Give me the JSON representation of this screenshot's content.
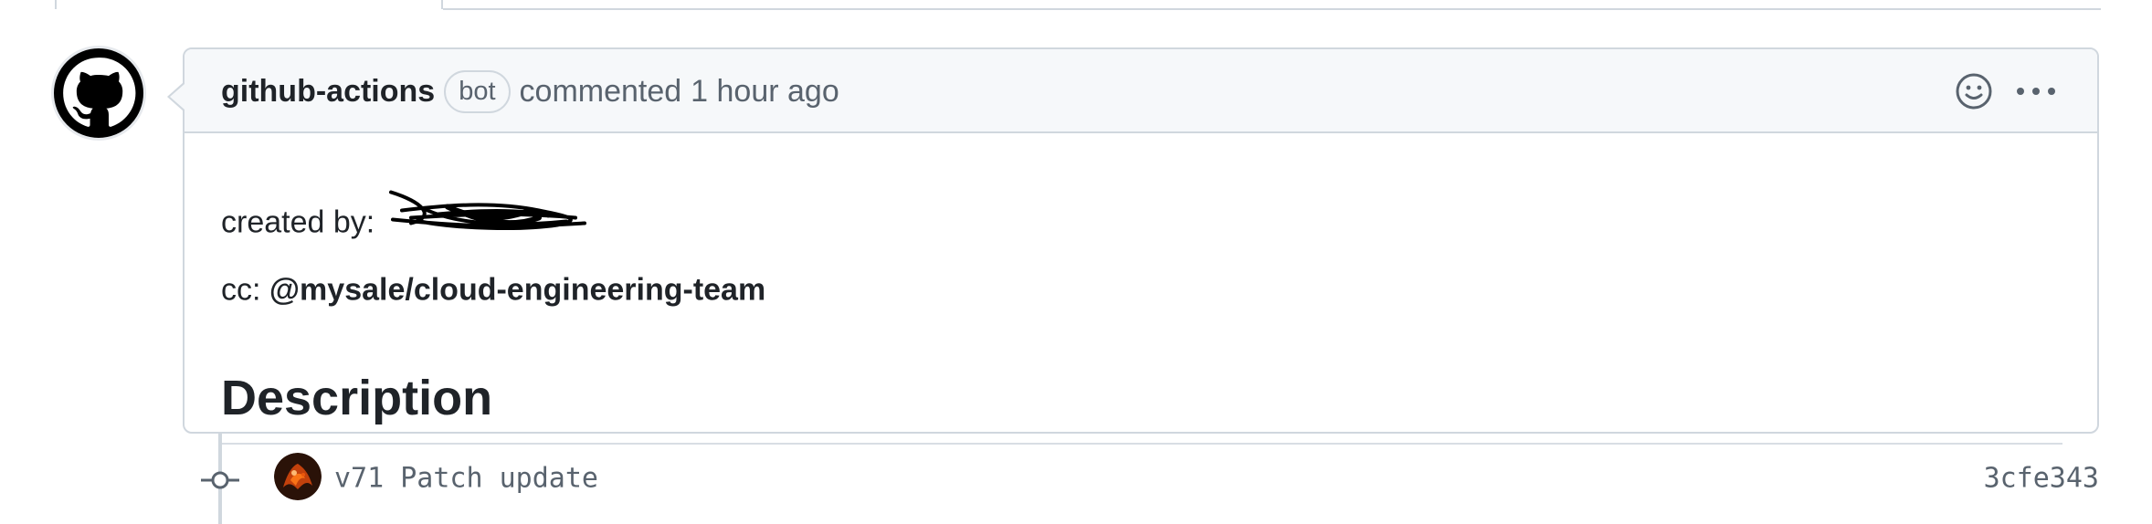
{
  "comment": {
    "author": "github-actions",
    "author_badge": "bot",
    "action": "commented",
    "timestamp": "1 hour ago",
    "avatar_icon": "github-octocat-icon",
    "header_icons": [
      "smiley-icon",
      "kebab-icon"
    ],
    "body": {
      "created_label": "created by:",
      "created_by_redacted": true,
      "cc_label": "cc:",
      "cc_team": "@mysale/cloud-engineering-team",
      "heading": "Description"
    }
  },
  "commit": {
    "message": "v71 Patch update",
    "sha": "3cfe343",
    "node_icon": "git-commit-icon"
  },
  "colors": {
    "border": "#d0d7de",
    "header_bg": "#f6f8fa",
    "muted_text": "#59636e",
    "text": "#1f2328"
  }
}
